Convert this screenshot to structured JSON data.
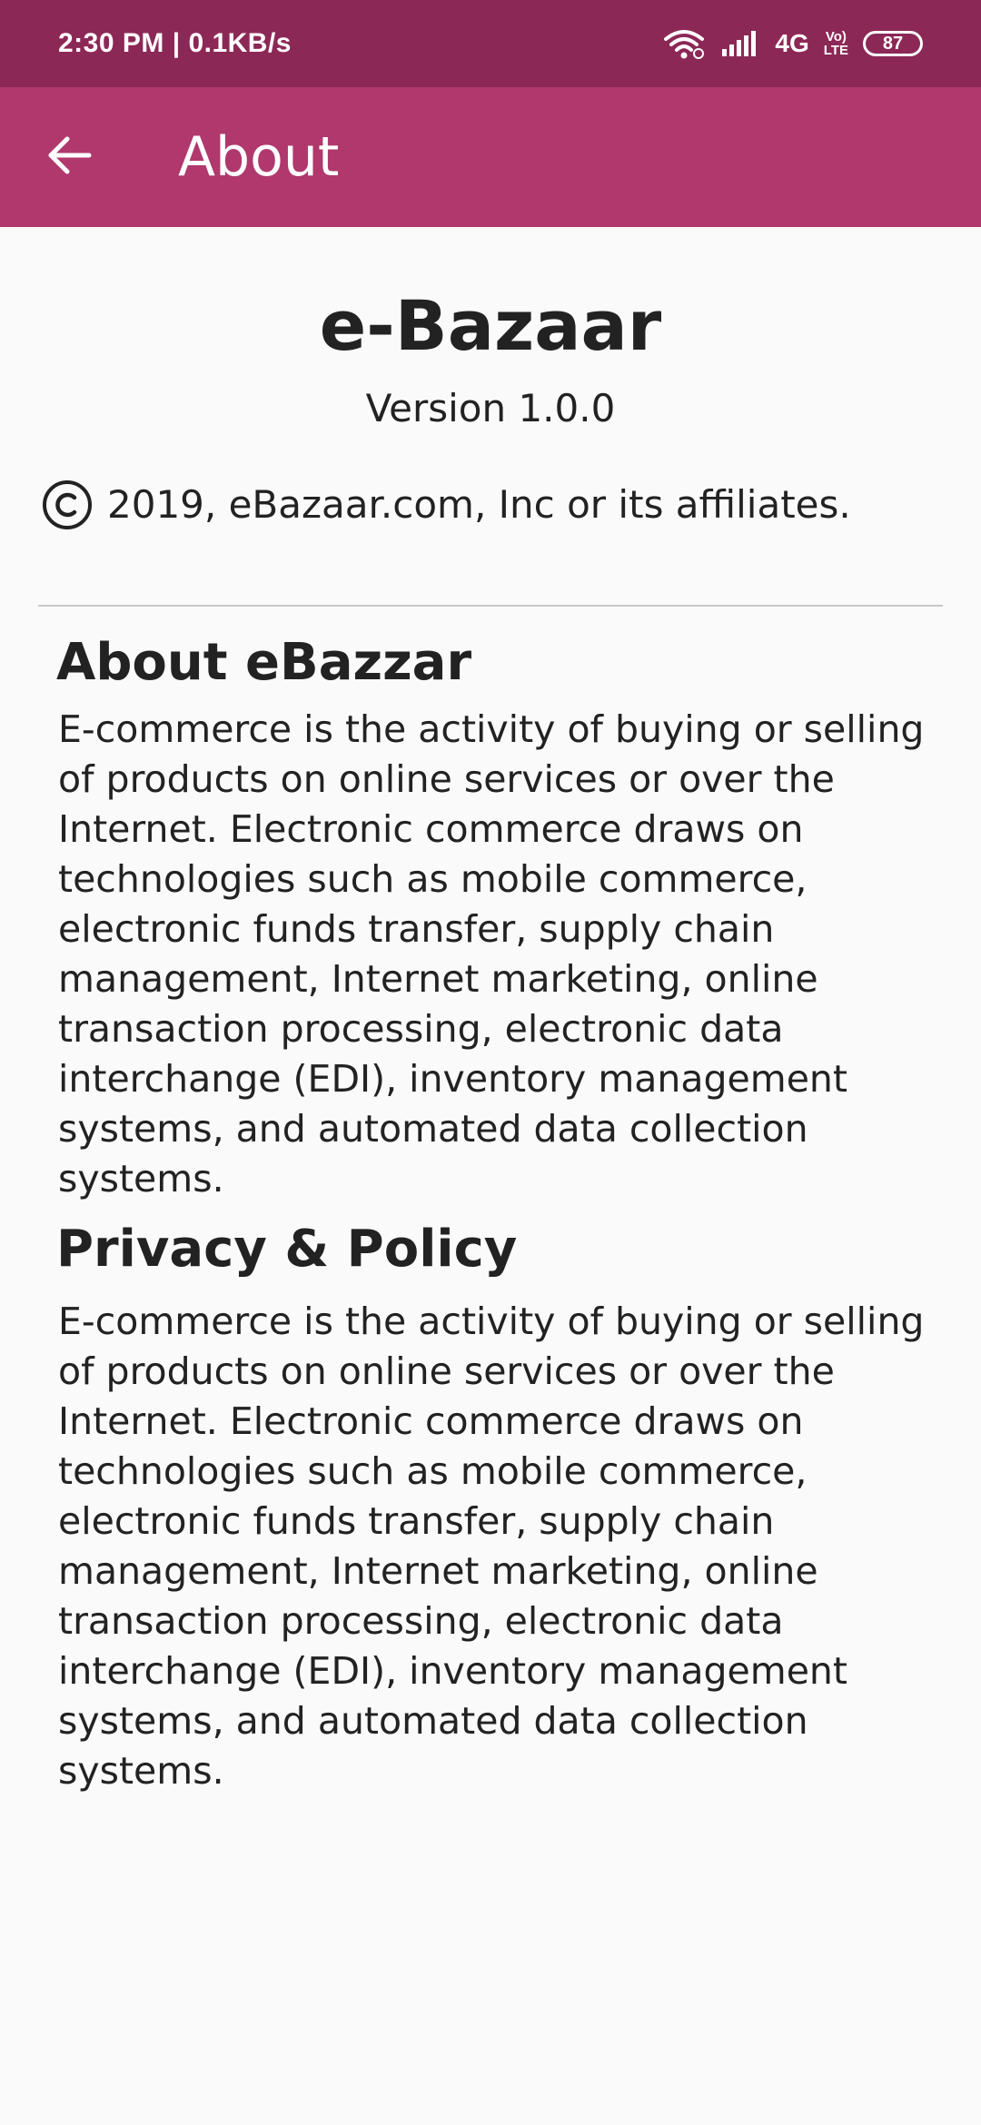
{
  "status_bar": {
    "time_speed": "2:30 PM | 0.1KB/s",
    "network": "4G",
    "volte_top": "Vo)",
    "volte_bottom": "LTE",
    "battery": "87"
  },
  "app_bar": {
    "title": "About",
    "back_icon": "arrow-left-icon"
  },
  "app_info": {
    "name": "e-Bazaar",
    "version": "Version 1.0.0",
    "copyright": "2019, eBazaar.com, Inc or its affiliates."
  },
  "sections": [
    {
      "title": "About eBazzar",
      "body": "E-commerce is the activity of buying or selling of products on online services or over the Internet. Electronic commerce draws on technologies such as mobile commerce, electronic funds transfer, supply chain management, Internet marketing, online transaction processing, electronic data interchange (EDI), inventory management systems, and automated data collection systems."
    },
    {
      "title": "Privacy & Policy",
      "body": "E-commerce is the activity of buying or selling of products on online services or over the Internet. Electronic commerce draws on technologies such as mobile commerce, electronic funds transfer, supply chain management, Internet marketing, online transaction processing, electronic data interchange (EDI), inventory management systems, and automated data collection systems."
    }
  ],
  "colors": {
    "status_bar": "#8c2856",
    "app_bar": "#b0386d",
    "background": "#fafafa"
  }
}
